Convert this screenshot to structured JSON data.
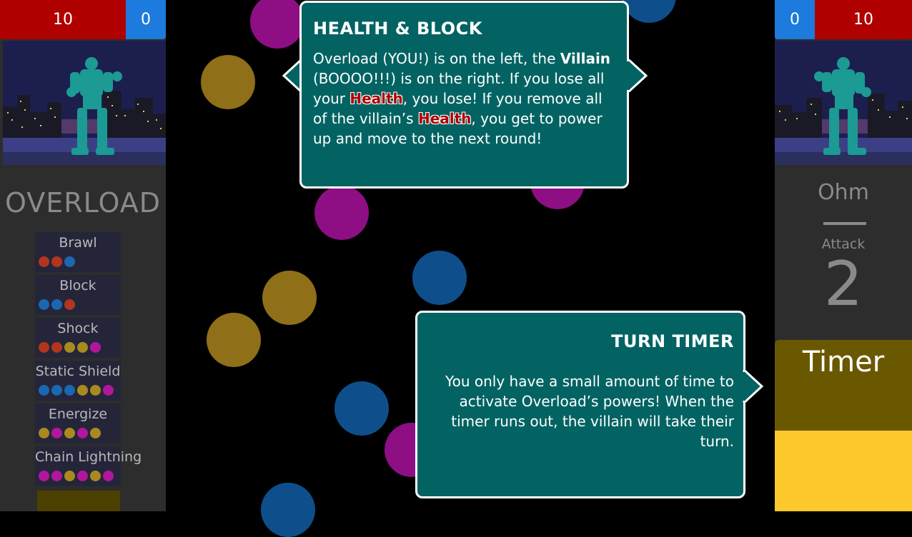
{
  "player": {
    "health": "10",
    "block": "0",
    "name": "OVERLOAD",
    "abilities": [
      {
        "name": "Brawl",
        "cost": [
          "red",
          "red",
          "blue"
        ]
      },
      {
        "name": "Block",
        "cost": [
          "blue",
          "blue",
          "red"
        ]
      },
      {
        "name": "Shock",
        "cost": [
          "red",
          "red",
          "gold",
          "gold",
          "magenta"
        ]
      },
      {
        "name": "Static Shield",
        "cost": [
          "blue",
          "blue",
          "blue",
          "gold",
          "gold",
          "magenta"
        ]
      },
      {
        "name": "Energize",
        "cost": [
          "gold",
          "magenta",
          "gold",
          "magenta",
          "gold"
        ]
      },
      {
        "name": "Chain Lightning",
        "cost": [
          "magenta",
          "magenta",
          "gold",
          "magenta",
          "gold",
          "magenta"
        ]
      }
    ]
  },
  "villain": {
    "block": "0",
    "health": "10",
    "name": "Ohm",
    "attack_label": "Attack",
    "attack_value": "2"
  },
  "timer": {
    "label": "Timer",
    "remaining_fraction": 0.47
  },
  "tooltips": {
    "health_block": {
      "title": "HEALTH & BLOCK",
      "t1": "Overload (YOU!) is on the left, the ",
      "t2": "Villain",
      "t3": " (BOOOO!!!) is on the right. If you lose all your ",
      "t4": "Health",
      "t5": ", you lose! If you remove all of the villain’s ",
      "t6": "Health",
      "t7": ", you get to power up and move to the next round!"
    },
    "turn_timer": {
      "title": "TURN TIMER",
      "body": "You only have a small amount of time to activate Overload’s powers! When the timer runs out, the villain will take their turn."
    }
  },
  "colors": {
    "red": "#b2361e",
    "blue": "#1b67b1",
    "gold": "#a88a1e",
    "magenta": "#b0179b",
    "tooltip_bg": "#036363",
    "health_bar": "#b00000",
    "block_bar": "#1c7bdc",
    "timer_fill": "#fcc82b"
  }
}
